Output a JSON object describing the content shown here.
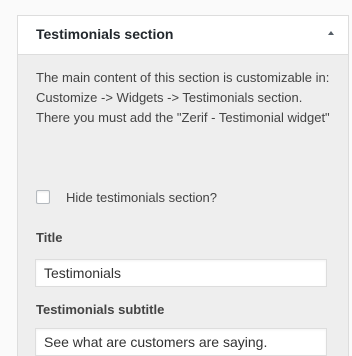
{
  "section": {
    "title": "Testimonials section",
    "description": "The main content of this section is customizable in: Customize -> Widgets -> Testimonials section. There you must add the \"Zerif - Testimonial widget\""
  },
  "hide_checkbox": {
    "label": "Hide testimonials section?",
    "checked": false
  },
  "fields": {
    "title_label": "Title",
    "title_value": "Testimonials",
    "subtitle_label": "Testimonials subtitle",
    "subtitle_value": "See what are customers are saying."
  },
  "icons": {
    "collapse": "collapse-arrow-icon"
  }
}
